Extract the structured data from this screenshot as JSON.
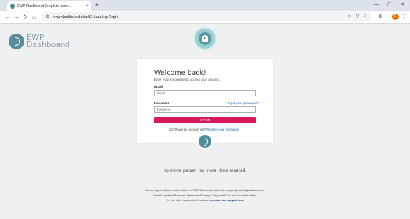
{
  "browser": {
    "tab_title": "EWP Dashboard | Login to acce...",
    "tab_close": "×",
    "new_tab": "+",
    "url": "ewp-dashboard-dev02.it.auth.gr/login",
    "window_controls": [
      "—",
      "▢",
      "✕"
    ],
    "profile_initial": "G"
  },
  "brand": {
    "line1": "EWP",
    "line2": "Dashboard"
  },
  "login": {
    "title": "Welcome back!",
    "subtitle": "Enter your credentials to access your account.",
    "email_label": "Email",
    "email_placeholder": "Email",
    "password_label": "Password",
    "password_placeholder": "Password",
    "forgot_link": "Forgot your password?",
    "login_button": "LOGIN",
    "signup_text": "Don't have an account yet?",
    "signup_link": "Register your institution!"
  },
  "footer": {
    "tagline": "no more paper, no more time wasted.",
    "line1_text": "Discover general information about the EWP Dashboard and other frequently asked questions",
    "line1_link": "here",
    "line2_text": "Find the updated Erasmus+ Dashboard Privacy Policy and Terms and Conditions",
    "line2_link": "here",
    "line3_text": "For any other issues, don't hesitate to",
    "line3_link": "contact our support team"
  }
}
